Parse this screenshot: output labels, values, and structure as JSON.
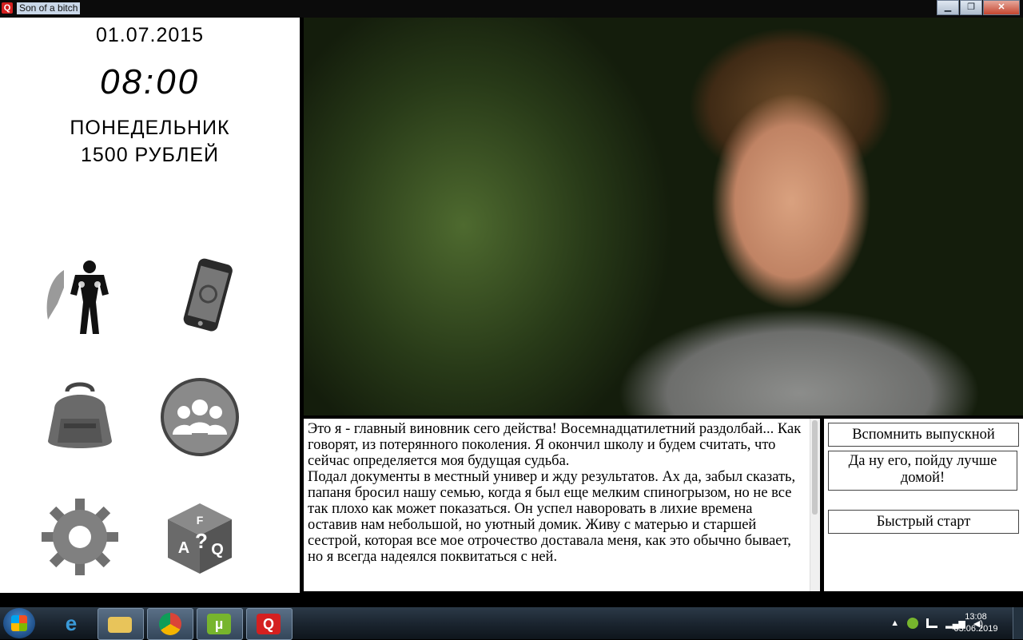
{
  "window": {
    "title": "Son of a bitch",
    "app_icon_letter": "Q",
    "minimize": "▁",
    "maximize": "❐",
    "close": "✕"
  },
  "status": {
    "date": "01.07.2015",
    "time": "08:00",
    "weekday": "ПОНЕДЕЛЬНИК",
    "money": "1500 РУБЛЕЙ"
  },
  "menu_icons": [
    "hero-icon",
    "phone-icon",
    "backpack-icon",
    "people-icon",
    "settings-gear-icon",
    "faq-cube-icon"
  ],
  "story": {
    "text": "Это я - главный виновник сего действа! Восемнадцатилетний раздолбай... Как говорят, из потерянного поколения. Я окончил школу и будем считать, что сейчас определяется моя будущая судьба.\nПодал документы в местный универ и жду результатов. Ах да, забыл сказать, папаня бросил нашу семью, когда я был еще мелким спиногрызом, но не все так плохо как может показаться. Он успел наворовать в лихие времена оставив нам небольшой, но уютный домик. Живу с матерью и старшей сестрой, которая все мое отрочество доставала меня, как это обычно бывает, но я всегда надеялся поквитаться с ней."
  },
  "choices": [
    "Вспомнить выпускной",
    "Да ну его, пойду лучше домой!",
    "Быстрый старт"
  ],
  "taskbar": {
    "items": [
      "internet-explorer",
      "file-explorer",
      "chrome",
      "utorrent",
      "game-app"
    ],
    "clock_time": "13:08",
    "clock_date": "03.06.2019"
  }
}
